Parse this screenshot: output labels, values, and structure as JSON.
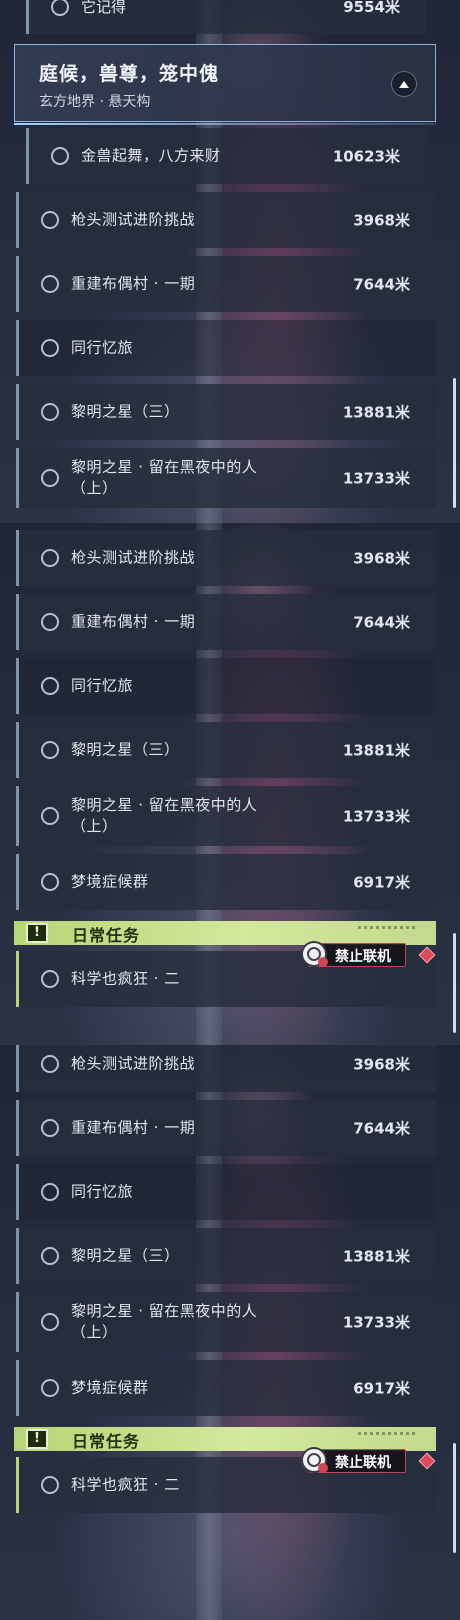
{
  "top_clipped": {
    "title": "它记得",
    "distance": "9554米"
  },
  "region": {
    "title": "庭候，兽尊，笼中傀",
    "subtitle": "玄方地界 · 悬天构"
  },
  "sub_quest": {
    "title": "金兽起舞，八方来财",
    "distance": "10623米"
  },
  "panel1": [
    {
      "title": "枪头测试进阶挑战",
      "distance": "3968米"
    },
    {
      "title": "重建布偶村 · 一期",
      "distance": "7644米"
    },
    {
      "title": "同行忆旅",
      "distance": ""
    },
    {
      "title": "黎明之星（三）",
      "distance": "13881米"
    },
    {
      "title": "黎明之星 · 留在黑夜中的人（上）",
      "distance": "13733米"
    }
  ],
  "panel2": [
    {
      "title": "枪头测试进阶挑战",
      "distance": "3968米"
    },
    {
      "title": "重建布偶村 · 一期",
      "distance": "7644米"
    },
    {
      "title": "同行忆旅",
      "distance": ""
    },
    {
      "title": "黎明之星（三）",
      "distance": "13881米"
    },
    {
      "title": "黎明之星 · 留在黑夜中的人（上）",
      "distance": "13733米"
    },
    {
      "title": "梦境症候群",
      "distance": "6917米"
    }
  ],
  "panel3": [
    {
      "title": "枪头测试进阶挑战",
      "distance": "3968米"
    },
    {
      "title": "重建布偶村 · 一期",
      "distance": "7644米"
    },
    {
      "title": "同行忆旅",
      "distance": ""
    },
    {
      "title": "黎明之星（三）",
      "distance": "13881米"
    },
    {
      "title": "黎明之星 · 留在黑夜中的人（上）",
      "distance": "13733米"
    },
    {
      "title": "梦境症候群",
      "distance": "6917米"
    }
  ],
  "daily": {
    "header": "日常任务",
    "icon_glyph": "!",
    "quest": "科学也疯狂 · 二",
    "badge": "禁止联机"
  },
  "icons": {
    "quest_status": "circle-icon",
    "collapse": "chevron-up-icon",
    "daily": "exclamation-icon",
    "no_coop": "no-multiplayer-icon",
    "alert": "diamond-alert-icon"
  },
  "colors": {
    "accent_daily": "#b6d676",
    "accent_quest": "#7f94a8",
    "badge_border": "#b54a55",
    "diamond": "#d94b5a"
  }
}
